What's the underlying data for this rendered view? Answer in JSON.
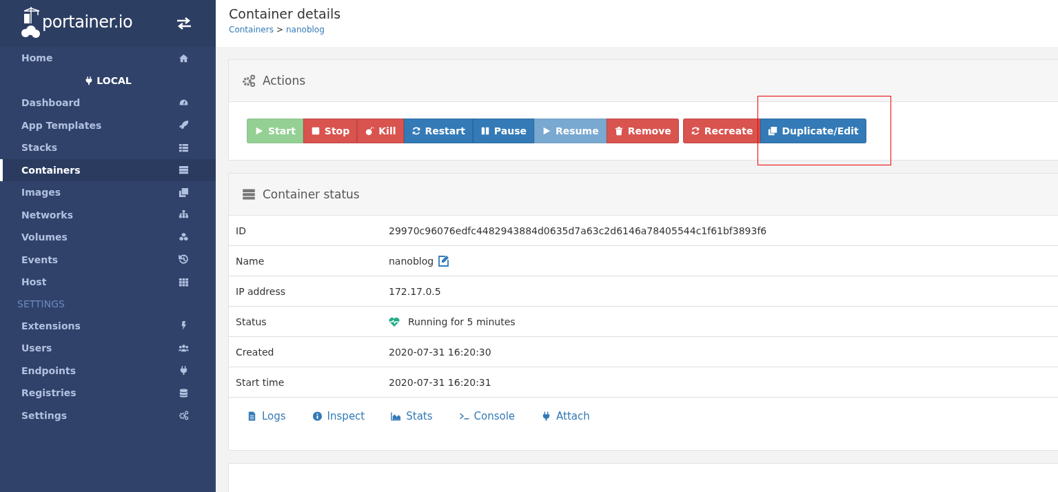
{
  "sidebar": {
    "logo_text": "portainer.io",
    "items": [
      {
        "label": "Home",
        "selected": false,
        "kind": "item"
      },
      {
        "label": "LOCAL",
        "kind": "endpoint"
      },
      {
        "label": "Dashboard",
        "selected": false,
        "kind": "item"
      },
      {
        "label": "App Templates",
        "selected": false,
        "kind": "item"
      },
      {
        "label": "Stacks",
        "selected": false,
        "kind": "item"
      },
      {
        "label": "Containers",
        "selected": true,
        "kind": "item"
      },
      {
        "label": "Images",
        "selected": false,
        "kind": "item"
      },
      {
        "label": "Networks",
        "selected": false,
        "kind": "item"
      },
      {
        "label": "Volumes",
        "selected": false,
        "kind": "item"
      },
      {
        "label": "Events",
        "selected": false,
        "kind": "item"
      },
      {
        "label": "Host",
        "selected": false,
        "kind": "item"
      },
      {
        "label": "SETTINGS",
        "kind": "heading"
      },
      {
        "label": "Extensions",
        "selected": false,
        "kind": "item"
      },
      {
        "label": "Users",
        "selected": false,
        "kind": "item"
      },
      {
        "label": "Endpoints",
        "selected": false,
        "kind": "item"
      },
      {
        "label": "Registries",
        "selected": false,
        "kind": "item"
      },
      {
        "label": "Settings",
        "selected": false,
        "kind": "item"
      }
    ]
  },
  "header": {
    "title": "Container details",
    "breadcrumb": [
      {
        "label": "Containers",
        "kind": "link"
      },
      {
        "label": ">",
        "kind": "separator"
      },
      {
        "label": "nanoblog",
        "kind": "link"
      }
    ]
  },
  "actions": {
    "title": "Actions",
    "groups": [
      [
        {
          "label": "Start",
          "kind": "success",
          "disabled": true,
          "annotated": false
        },
        {
          "label": "Stop",
          "kind": "danger",
          "disabled": false,
          "annotated": false
        },
        {
          "label": "Kill",
          "kind": "danger",
          "disabled": false,
          "annotated": false
        },
        {
          "label": "Restart",
          "kind": "primary",
          "disabled": false,
          "annotated": false
        },
        {
          "label": "Pause",
          "kind": "primary",
          "disabled": false,
          "annotated": false
        },
        {
          "label": "Resume",
          "kind": "primary",
          "disabled": true,
          "annotated": false
        },
        {
          "label": "Remove",
          "kind": "danger",
          "disabled": false,
          "annotated": false
        }
      ],
      [
        {
          "label": "Recreate",
          "kind": "danger",
          "disabled": false,
          "annotated": false
        },
        {
          "label": "Duplicate/Edit",
          "kind": "primary",
          "disabled": false,
          "annotated": true
        }
      ]
    ]
  },
  "status": {
    "title": "Container status",
    "rows": [
      {
        "label": "ID",
        "value": "29970c96076edfc4482943884d0635d7a63c2d6146a78405544c1f61bf3893f6",
        "kind": "text"
      },
      {
        "label": "Name",
        "value": "nanoblog",
        "kind": "editable"
      },
      {
        "label": "IP address",
        "value": "172.17.0.5",
        "kind": "text"
      },
      {
        "label": "Status",
        "value": "Running for 5 minutes",
        "kind": "health"
      },
      {
        "label": "Created",
        "value": "2020-07-31 16:20:30",
        "kind": "text"
      },
      {
        "label": "Start time",
        "value": "2020-07-31 16:20:31",
        "kind": "text"
      }
    ],
    "links": [
      "Logs",
      "Inspect",
      "Stats",
      "Console",
      "Attach"
    ]
  }
}
